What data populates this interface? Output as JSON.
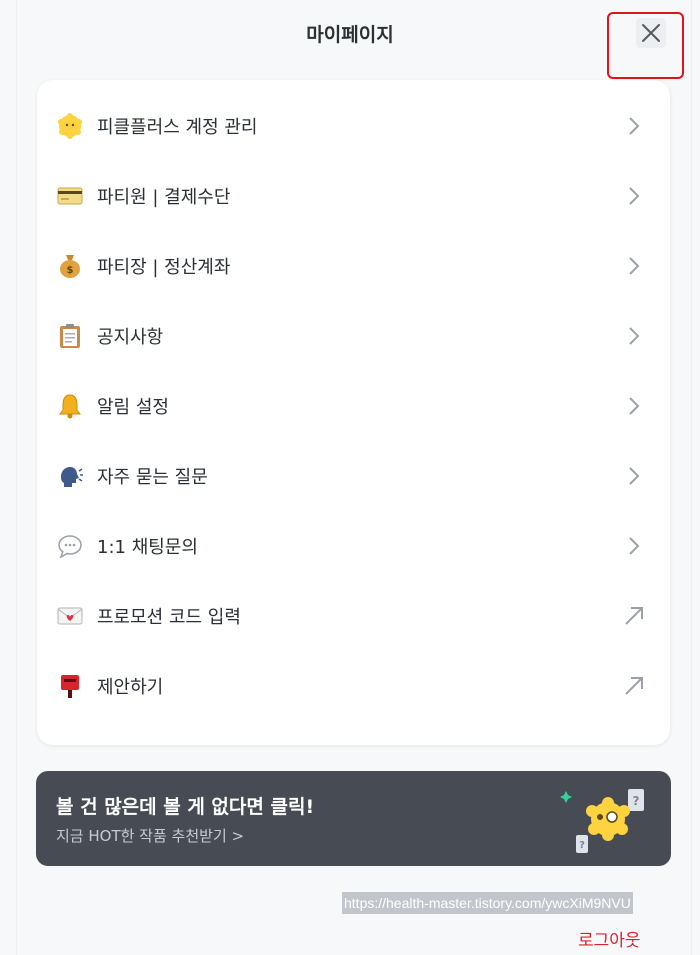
{
  "header": {
    "title": "마이페이지"
  },
  "menu": {
    "items": [
      {
        "label": "피클플러스 계정 관리",
        "icon": "face-icon",
        "arrow": "chevron-right"
      },
      {
        "label": "파티원 | 결제수단",
        "icon": "credit-card-icon",
        "arrow": "chevron-right"
      },
      {
        "label": "파티장 | 정산계좌",
        "icon": "money-bag-icon",
        "arrow": "chevron-right"
      },
      {
        "label": "공지사항",
        "icon": "clipboard-icon",
        "arrow": "chevron-right"
      },
      {
        "label": "알림 설정",
        "icon": "bell-icon",
        "arrow": "chevron-right"
      },
      {
        "label": "자주 묻는 질문",
        "icon": "speaking-head-icon",
        "arrow": "chevron-right"
      },
      {
        "label": "1:1 채팅문의",
        "icon": "speech-bubble-icon",
        "arrow": "chevron-right"
      },
      {
        "label": "프로모션 코드 입력",
        "icon": "love-letter-icon",
        "arrow": "external-arrow"
      },
      {
        "label": "제안하기",
        "icon": "postbox-icon",
        "arrow": "external-arrow"
      }
    ]
  },
  "banner": {
    "title": "볼 건 많은데 볼 게 없다면 클릭!",
    "subtitle": "지금 HOT한 작품 추천받기 >"
  },
  "footer": {
    "url": "https://health-master.tistory.com/ywcXiM9NVU",
    "logout_label": "로그아웃"
  },
  "colors": {
    "background": "#f7f8fa",
    "card": "#ffffff",
    "banner": "#474c54",
    "logout": "#d9232d",
    "highlight": "#e0141b"
  }
}
